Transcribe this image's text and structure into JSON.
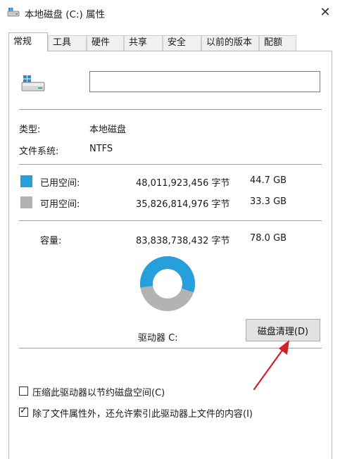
{
  "window": {
    "title": "本地磁盘 (C:) 属性",
    "close_label": "✕"
  },
  "tabs": [
    {
      "label": "常规",
      "active": true
    },
    {
      "label": "工具"
    },
    {
      "label": "硬件"
    },
    {
      "label": "共享"
    },
    {
      "label": "安全"
    },
    {
      "label": "以前的版本"
    },
    {
      "label": "配额"
    }
  ],
  "general": {
    "name_value": "",
    "type_label": "类型:",
    "type_value": "本地磁盘",
    "fs_label": "文件系统:",
    "fs_value": "NTFS",
    "used": {
      "label": "已用空间:",
      "bytes": "48,011,923,456 字节",
      "size": "44.7 GB",
      "color": "#26a0da"
    },
    "free": {
      "label": "可用空间:",
      "bytes": "35,826,814,976 字节",
      "size": "33.3 GB",
      "color": "#b3b3b3"
    },
    "capacity": {
      "label": "容量:",
      "bytes": "83,838,738,432 字节",
      "size": "78.0 GB"
    },
    "drive_label": "驱动器 C:",
    "cleanup_button": "磁盘清理(D)",
    "used_fraction": 0.573,
    "compress_label": "压缩此驱动器以节约磁盘空间(C)",
    "compress_checked": false,
    "index_label": "除了文件属性外，还允许索引此驱动器上文件的内容(I)",
    "index_checked": true
  },
  "icons": {
    "title_icon": "drive-icon",
    "drive_icon": "drive-windows-icon",
    "arrow": "annotation-arrow-icon"
  },
  "colors": {
    "accent_arrow": "#d0202a",
    "used": "#26a0da",
    "free": "#b3b3b3"
  }
}
